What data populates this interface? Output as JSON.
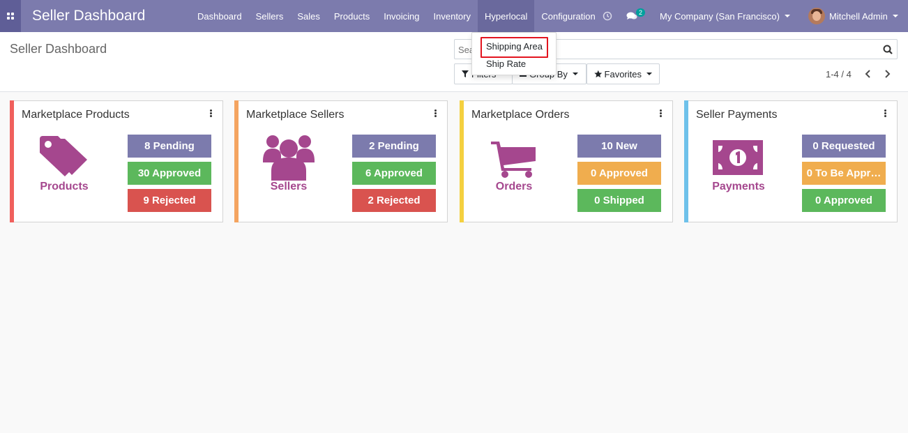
{
  "navbar": {
    "brand": "Seller Dashboard",
    "menu": [
      "Dashboard",
      "Sellers",
      "Sales",
      "Products",
      "Invoicing",
      "Inventory",
      "Hyperlocal",
      "Configuration"
    ],
    "active_menu": "Hyperlocal",
    "chat_count": "2",
    "company": "My Company (San Francisco)",
    "user": "Mitchell Admin",
    "color": "#7c7bad"
  },
  "dropdown": {
    "items": [
      "Shipping Area",
      "Ship Rate"
    ],
    "highlighted": "Shipping Area"
  },
  "control": {
    "title": "Seller Dashboard",
    "search_placeholder": "Search...",
    "filters_label": "Filters",
    "groupby_label": "Group By",
    "favorites_label": "Favorites",
    "pager": "1-4 / 4"
  },
  "cards": [
    {
      "title": "Marketplace Products",
      "label": "Products",
      "icon": "tags-icon",
      "accent": "#f0605d",
      "stats": [
        {
          "text": "8 Pending",
          "color": "purple"
        },
        {
          "text": "30 Approved",
          "color": "green"
        },
        {
          "text": "9 Rejected",
          "color": "red"
        }
      ]
    },
    {
      "title": "Marketplace Sellers",
      "label": "Sellers",
      "icon": "users-icon",
      "accent": "#f4a460",
      "stats": [
        {
          "text": "2 Pending",
          "color": "purple"
        },
        {
          "text": "6 Approved",
          "color": "green"
        },
        {
          "text": "2 Rejected",
          "color": "red"
        }
      ]
    },
    {
      "title": "Marketplace Orders",
      "label": "Orders",
      "icon": "shopping-cart-icon",
      "accent": "#f4d03f",
      "stats": [
        {
          "text": "10 New",
          "color": "purple"
        },
        {
          "text": "0 Approved",
          "color": "orange"
        },
        {
          "text": "0 Shipped",
          "color": "green"
        }
      ]
    },
    {
      "title": "Seller Payments",
      "label": "Payments",
      "icon": "money-icon",
      "accent": "#6ec1ea",
      "stats": [
        {
          "text": "0 Requested",
          "color": "purple"
        },
        {
          "text": "0 To Be Appr…",
          "color": "orange"
        },
        {
          "text": "0 Approved",
          "color": "green"
        }
      ]
    }
  ]
}
